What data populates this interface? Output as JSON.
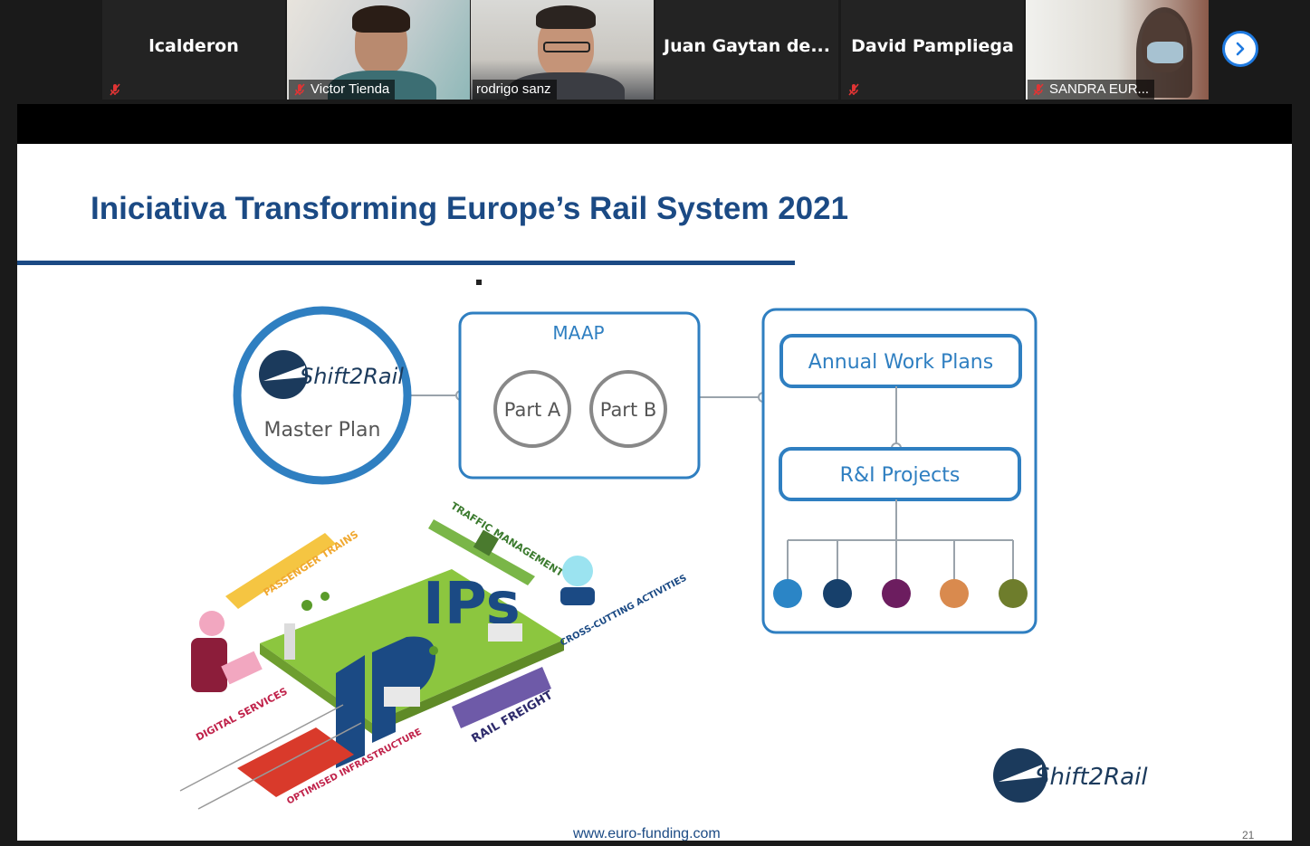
{
  "participants": [
    {
      "name": "lcalderon",
      "muted": true
    },
    {
      "name": "Victor Tienda",
      "muted": true
    },
    {
      "name": "rodrigo sanz",
      "muted": false
    },
    {
      "name": "Juan Gaytan de...",
      "muted": false
    },
    {
      "name": "David Pampliega",
      "muted": true
    },
    {
      "name": "SANDRA EUR...",
      "muted": true
    }
  ],
  "slide": {
    "title": "Iniciativa Transforming Europe’s Rail System 2021",
    "master_plan": {
      "brand": "Shift2Rail",
      "label": "Master Plan"
    },
    "maap": {
      "title": "MAAP",
      "part_a": "Part A",
      "part_b": "Part B"
    },
    "annual": {
      "title": "Annual  Work Plans",
      "projects": "R&I Projects"
    },
    "dots": [
      "#2b85c6",
      "#17406b",
      "#6c1d5f",
      "#d98a4e",
      "#6e7d2c"
    ],
    "illustration": {
      "ips": "IPs",
      "traffic": "TRAFFIC MANAGEMENT",
      "passenger": "PASSENGER TRAINS",
      "cross": "CROSS-CUTTING ACTIVITIES",
      "digital": "DIGITAL SERVICES",
      "infra": "OPTIMISED INFRASTRUCTURE",
      "freight": "RAIL FREIGHT"
    },
    "logo": "Shift2Rail",
    "footer_url": "www.euro-funding.com",
    "page_number": "21"
  },
  "colors": {
    "brand_blue": "#1b4a84",
    "frame_blue": "#2f7fc1",
    "active_speaker": "#9bd13a"
  }
}
